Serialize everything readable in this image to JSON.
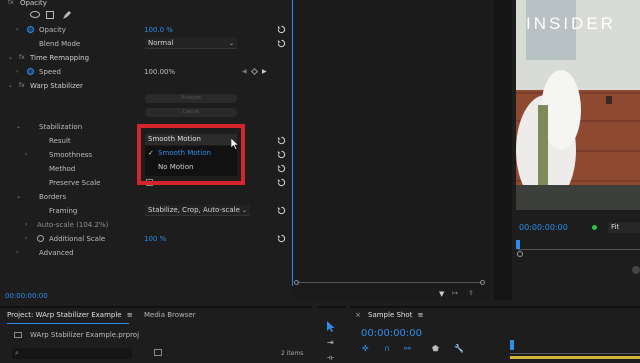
{
  "effects": {
    "opacity_header": "Opacity",
    "opacity_label": "Opacity",
    "opacity_value": "100.0 %",
    "blend_label": "Blend Mode",
    "blend_value": "Normal",
    "time_remap_header": "Time Remapping",
    "speed_label": "Speed",
    "speed_value": "100.00%",
    "warp_header": "Warp Stabilizer",
    "analyze_label": "Analyze",
    "cancel_label": "Cancel",
    "stabilization_label": "Stabilization",
    "result_label": "Result",
    "smoothness_label": "Smoothness",
    "method_label": "Method",
    "preserve_scale_label": "Preserve Scale",
    "borders_label": "Borders",
    "framing_label": "Framing",
    "framing_value": "Stabilize, Crop, Auto-scale",
    "autoscale_label": "Auto-scale (104.2%)",
    "additional_scale_label": "Additional Scale",
    "additional_scale_value": "100 %",
    "advanced_label": "Advanced",
    "timecode": "00:00:00:00"
  },
  "dropdown": {
    "selected": "Smooth Motion",
    "options": [
      {
        "label": "Smooth Motion",
        "checked": true
      },
      {
        "label": "No Motion",
        "checked": false
      }
    ],
    "highlight_color": "#d4252b"
  },
  "program": {
    "watermark": "INSIDER",
    "timecode": "00:00:00:00",
    "fit_label": "Fit"
  },
  "project": {
    "tab_project": "Project: WArp Stabilizer Example",
    "tab_media": "Media Browser",
    "file_name": "WArp Stabilizer Example.prproj",
    "item_count": "2 items"
  },
  "timeline": {
    "tab_label": "Sample Shot",
    "timecode": "00:00:00:00"
  },
  "colors": {
    "accent_blue": "#2d8ceb",
    "panel_bg": "#1d1d1d"
  }
}
